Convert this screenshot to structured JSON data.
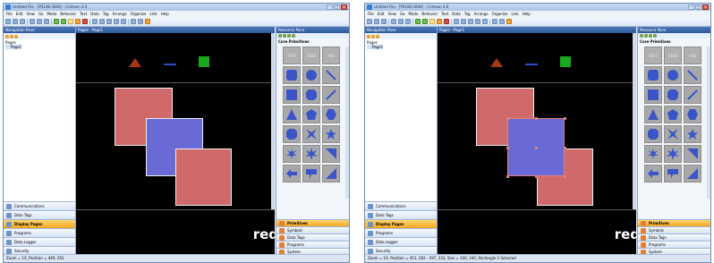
{
  "panels": [
    {
      "window_title": "Untitled File - [PS108-3000] - Crimson 3.0",
      "menu": [
        "File",
        "Edit",
        "View",
        "Go",
        "Mode",
        "Behavior",
        "Text",
        "Data",
        "Tag",
        "Arrange",
        "Organize",
        "Link",
        "Help"
      ],
      "nav_title": "Navigation Pane",
      "editor_title": "Pages - Page1",
      "tree": [
        "Pages",
        "Page1"
      ],
      "nav_sections": [
        "Communications",
        "Data Tags",
        "Display Pages",
        "Programs",
        "Data Logger",
        "Security"
      ],
      "active_nav_section": "Display Pages",
      "resource_title": "Resource Pane",
      "resource_subtitle": "Core Primitives",
      "text_cells": [
        "TEXT",
        "5658",
        "448"
      ],
      "resource_sections": [
        "Primitives",
        "Symbols",
        "Data Tags",
        "Programs",
        "System"
      ],
      "status": "Zoom = 1X, Position = 449, 201",
      "logo": "red",
      "selected_shape": null
    },
    {
      "window_title": "Untitled File - [PS108-3000] - Crimson 3.0",
      "menu": [
        "File",
        "Edit",
        "View",
        "Go",
        "Mode",
        "Behavior",
        "Text",
        "Data",
        "Tag",
        "Arrange",
        "Organize",
        "Link",
        "Help"
      ],
      "nav_title": "Navigation Pane",
      "editor_title": "Pages - Page1",
      "tree": [
        "Pages",
        "Page1"
      ],
      "nav_sections": [
        "Communications",
        "Data Tags",
        "Display Pages",
        "Programs",
        "Data Logger",
        "Security"
      ],
      "active_nav_section": "Display Pages",
      "resource_title": "Resource Pane",
      "resource_subtitle": "Core Primitives",
      "text_cells": [
        "TEXT",
        "5658",
        "448"
      ],
      "resource_sections": [
        "Primitives",
        "Symbols",
        "Data Tags",
        "Programs",
        "System"
      ],
      "status": "Zoom = 1X, Position = 451, 283 - 297, 233, Size = 100, 100, Rectangle 2 Selected",
      "logo": "red",
      "selected_shape": "blue-rect"
    }
  ],
  "colors": {
    "red_rect": "#d06a6a",
    "blue_rect": "#6a6ad6",
    "triangle": "#a23a14",
    "line": "#2a4dd0",
    "green_square": "#1aa820",
    "handle": "#e0817a"
  }
}
